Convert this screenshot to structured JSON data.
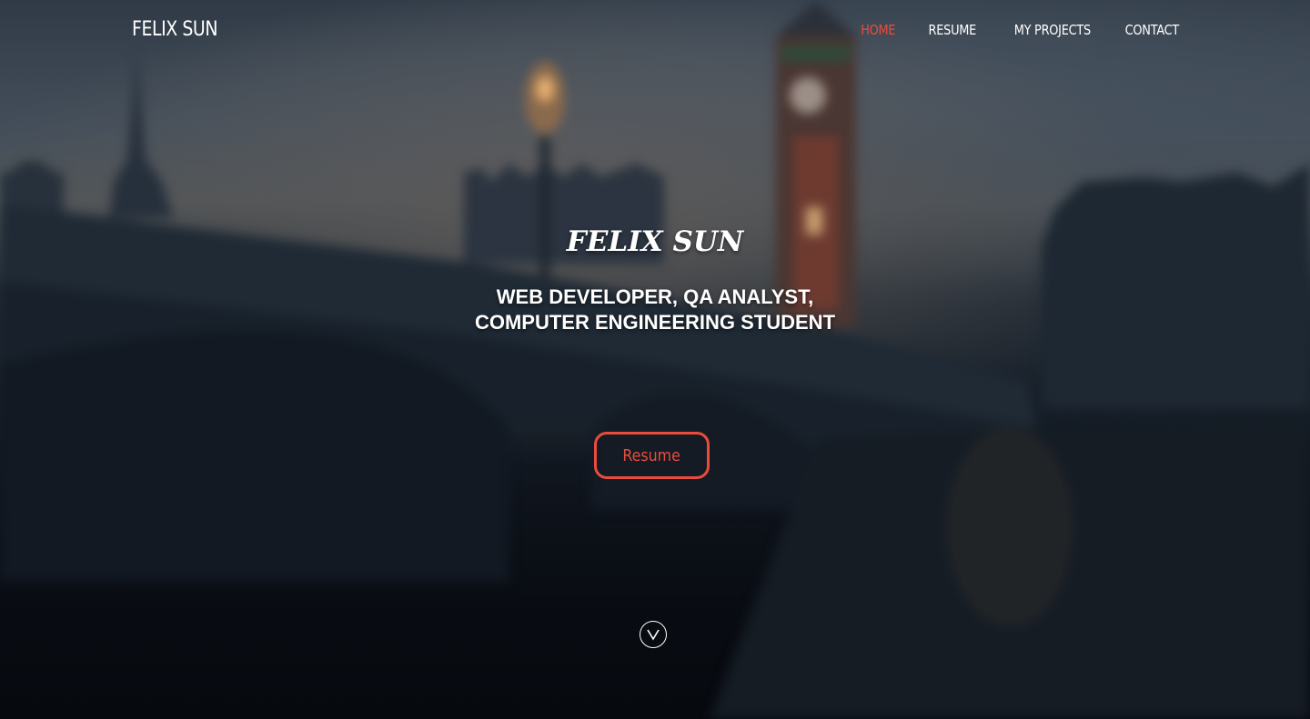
{
  "header": {
    "brand": "FELIX SUN",
    "nav": [
      {
        "label": "HOME",
        "active": true
      },
      {
        "label": "RESUME",
        "active": false
      },
      {
        "label": "MY PROJECTS",
        "active": false
      },
      {
        "label": "CONTACT",
        "active": false
      }
    ]
  },
  "hero": {
    "title": "FELIX SUN",
    "subtitle_line1": "WEB DEVELOPER, QA ANALYST,",
    "subtitle_line2": "COMPUTER ENGINEERING STUDENT",
    "cta_label": "Resume",
    "scroll_icon": "chevron-down-circle-icon"
  },
  "colors": {
    "accent": "#ea4c3c",
    "text": "#ffffff"
  }
}
